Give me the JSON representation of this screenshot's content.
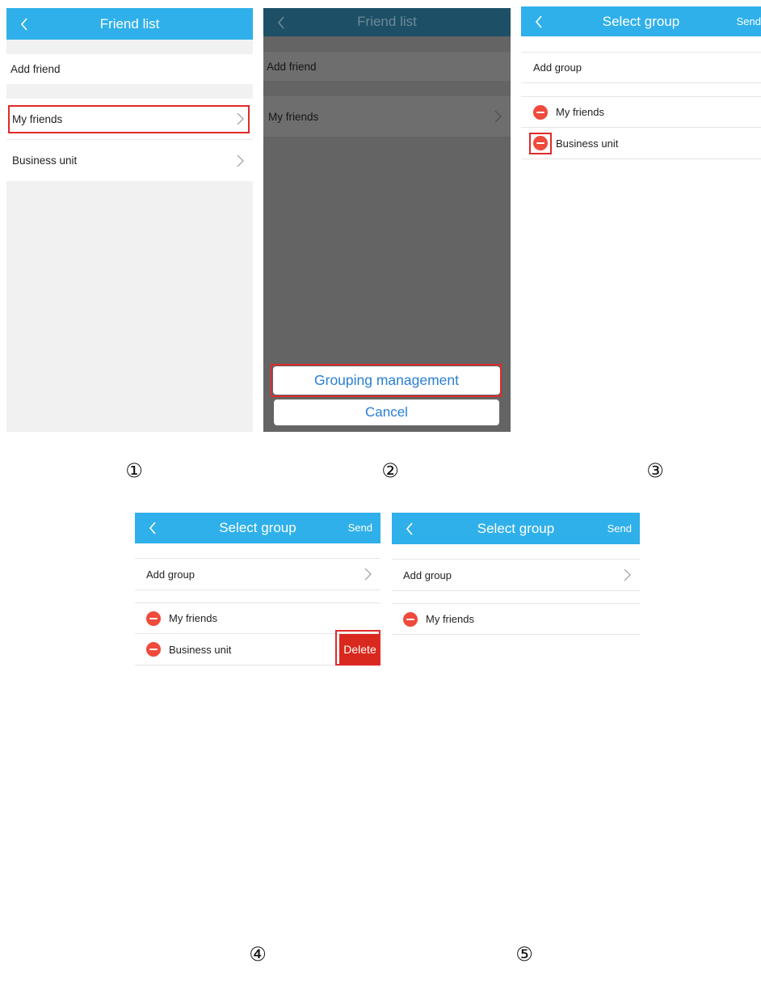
{
  "steps": [
    "①",
    "②",
    "③",
    "④",
    "⑤"
  ],
  "screen1": {
    "title": "Friend list",
    "items": [
      "Add friend",
      "My friends",
      "Business unit"
    ]
  },
  "screen2": {
    "title": "Friend list",
    "items": [
      "Add friend",
      "My friends"
    ],
    "sheet": {
      "primary": "Grouping management",
      "cancel": "Cancel"
    }
  },
  "screen3": {
    "title": "Select group",
    "action": "Send",
    "add_label": "Add group",
    "groups": [
      "My friends",
      "Business unit"
    ]
  },
  "screen4": {
    "title": "Select group",
    "action": "Send",
    "add_label": "Add group",
    "groups": [
      "My friends",
      "Business unit"
    ],
    "delete_label": "Delete"
  },
  "screen5": {
    "title": "Select group",
    "action": "Send",
    "add_label": "Add group",
    "groups": [
      "My friends"
    ]
  },
  "colors": {
    "nav": "#2fb0ea",
    "highlight": "#e02a2a",
    "delete": "#d9281e",
    "minus": "#ef4a3c",
    "link": "#2a7fd4"
  },
  "icons": [
    "chevron-left-icon",
    "chevron-right-icon",
    "remove-circle-icon"
  ]
}
